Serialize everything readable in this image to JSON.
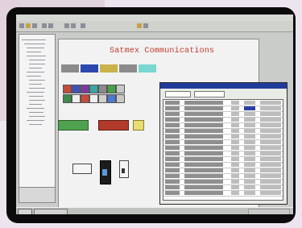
{
  "app": {
    "title": "Satmex Communications"
  },
  "menubar": {
    "items": [
      "",
      "",
      "",
      "",
      "",
      ""
    ]
  },
  "taskbar": {
    "start_label": "",
    "tray_label": ""
  },
  "colors": {
    "title_red": "#c23a2a",
    "dialog_title_blue": "#203c9a",
    "selected_row": "#2b3fa8",
    "cell_dark": "#8f8f8f"
  }
}
